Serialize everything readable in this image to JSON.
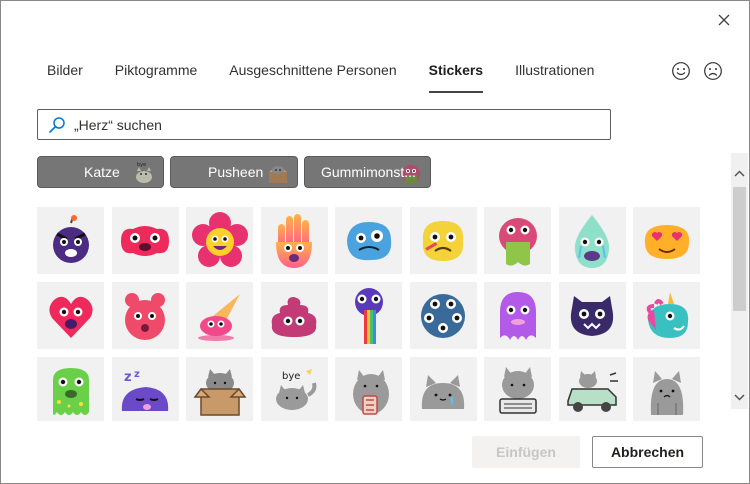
{
  "close_label": "✕",
  "tabs": [
    {
      "label": "Bilder",
      "active": false
    },
    {
      "label": "Piktogramme",
      "active": false
    },
    {
      "label": "Ausgeschnittene Personen",
      "active": false
    },
    {
      "label": "Stickers",
      "active": true
    },
    {
      "label": "Illustrationen",
      "active": false
    }
  ],
  "feedback": {
    "positive_icon": "smile-icon",
    "negative_icon": "frown-icon"
  },
  "search": {
    "placeholder": "„Herz“ suchen",
    "value": ""
  },
  "chips": [
    {
      "label": "Katze",
      "icon": "bye-cat-sticker"
    },
    {
      "label": "Pusheen",
      "icon": "box-cat-sticker"
    },
    {
      "label": "Gummimonst...",
      "icon": "gummy-monster-sticker"
    }
  ],
  "stickers": [
    "bomb-monster",
    "red-blob-monster",
    "flower-monster",
    "hand-monster",
    "blue-blob-monster",
    "sick-monster",
    "drooling-monster",
    "crying-monster",
    "heart-eyes-monster",
    "heart-monster",
    "gummy-bear-monster",
    "ice-cream-monster",
    "poop-monster",
    "rainbow-tongue-monster",
    "five-eyed-monster",
    "purple-ghost-monster",
    "cat-monster",
    "unicorn-monster",
    "spiky-green-monster",
    "sleeping-purple-monster",
    "pusheen-box",
    "pusheen-bye",
    "pusheen-cup",
    "pusheen-sad",
    "pusheen-typing",
    "pusheen-car",
    "pusheen-standing"
  ],
  "colors": {
    "chip_bg": "#767676",
    "tile_bg": "#f1f1f1",
    "accent": "#0078d4"
  },
  "buttons": {
    "insert": "Einfügen",
    "cancel": "Abbrechen"
  }
}
